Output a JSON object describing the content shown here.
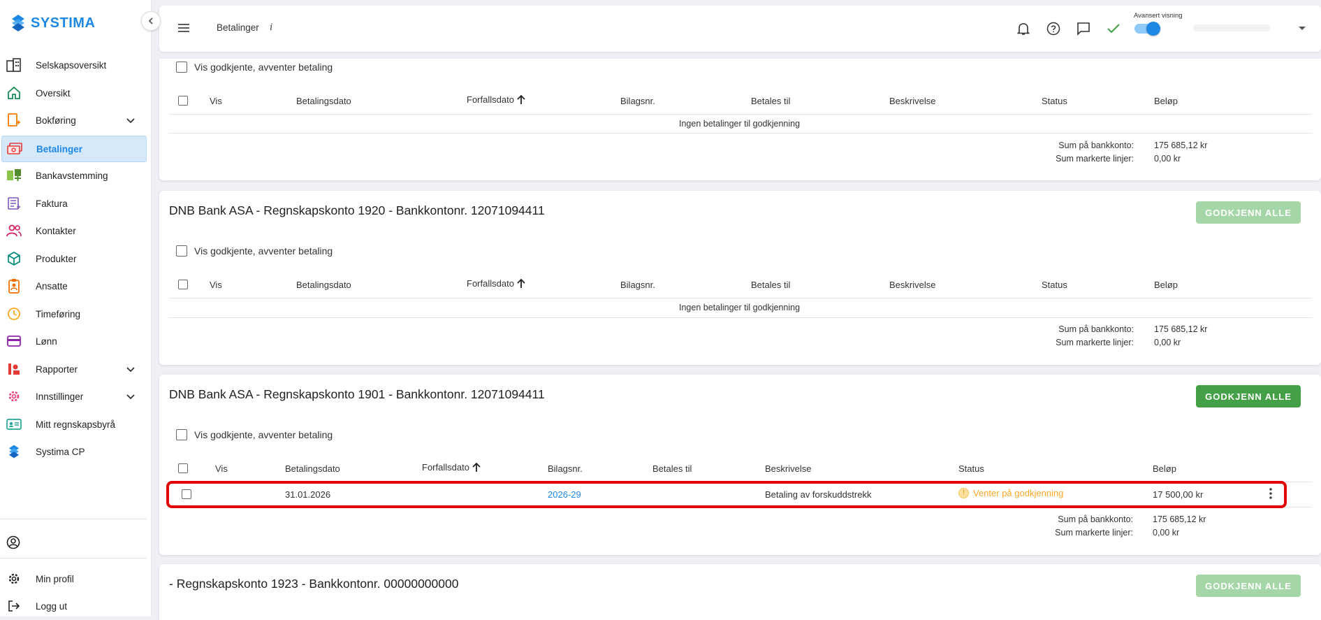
{
  "brand": {
    "name": "SYSTIMA",
    "color": "#1e88e5"
  },
  "sidebar": {
    "items": [
      {
        "label": "Selskapsoversikt",
        "icon": "company-overview-icon"
      },
      {
        "label": "Oversikt",
        "icon": "home-icon"
      },
      {
        "label": "Bokføring",
        "icon": "bookkeeping-icon"
      },
      {
        "label": "Betalinger",
        "icon": "payments-icon"
      },
      {
        "label": "Bankavstemming",
        "icon": "bank-reconciliation-icon"
      },
      {
        "label": "Faktura",
        "icon": "invoice-icon"
      },
      {
        "label": "Kontakter",
        "icon": "contacts-icon"
      },
      {
        "label": "Produkter",
        "icon": "products-icon"
      },
      {
        "label": "Ansatte",
        "icon": "employees-icon"
      },
      {
        "label": "Timeføring",
        "icon": "clock-icon"
      },
      {
        "label": "Lønn",
        "icon": "payroll-icon"
      },
      {
        "label": "Rapporter",
        "icon": "reports-icon"
      },
      {
        "label": "Innstillinger",
        "icon": "gear-icon"
      },
      {
        "label": "Mitt regnskapsbyrå",
        "icon": "accounting-firm-icon"
      },
      {
        "label": "Systima CP",
        "icon": "systima-cp-icon"
      }
    ],
    "active": "Betalinger",
    "bottom": {
      "profile_label": "Min profil",
      "logout_label": "Logg ut"
    }
  },
  "header": {
    "title": "Betalinger",
    "info": "i",
    "advanced_view_label": "Avansert visning",
    "advanced_view_on": true
  },
  "payments": {
    "show_approved_label": "Vis godkjente, avventer betaling",
    "approve_all_label": "GODKJENN ALLE",
    "columns": {
      "vis": "Vis",
      "payment_date": "Betalingsdato",
      "due_date": "Forfallsdato",
      "voucher_no": "Bilagsnr.",
      "pay_to": "Betales til",
      "description": "Beskrivelse",
      "status": "Status",
      "amount": "Beløp"
    },
    "empty_text": "Ingen betalinger til godkjenning",
    "sum_bank_label": "Sum på bankkonto:",
    "sum_marked_label": "Sum markerte linjer:",
    "accounts": [
      {
        "title": "",
        "sum_bank": "175 685,12 kr",
        "sum_marked": "0,00 kr"
      },
      {
        "title": "DNB Bank ASA - Regnskapskonto 1920 - Bankkontonr. 12071094411",
        "approve_enabled": false,
        "sum_bank": "175 685,12 kr",
        "sum_marked": "0,00 kr"
      },
      {
        "title": "DNB Bank ASA - Regnskapskonto 1901 - Bankkontonr. 12071094411",
        "approve_enabled": true,
        "rows": [
          {
            "payment_date": "31.01.2026",
            "due_date": "",
            "voucher_no": "2026-29",
            "pay_to": "",
            "description": "Betaling av forskuddstrekk",
            "status": "Venter på godkjenning",
            "amount": "17 500,00 kr"
          }
        ],
        "sum_bank": "175 685,12 kr",
        "sum_marked": "0,00 kr"
      },
      {
        "title": "- Regnskapskonto 1923 - Bankkontonr. 00000000000",
        "approve_enabled": false
      }
    ]
  },
  "colors": {
    "accent": "#1e88e5",
    "approve_enabled": "#43a047",
    "approve_disabled": "#a5d6a7",
    "pending_status": "#f9a825",
    "highlight": "#e30000"
  }
}
